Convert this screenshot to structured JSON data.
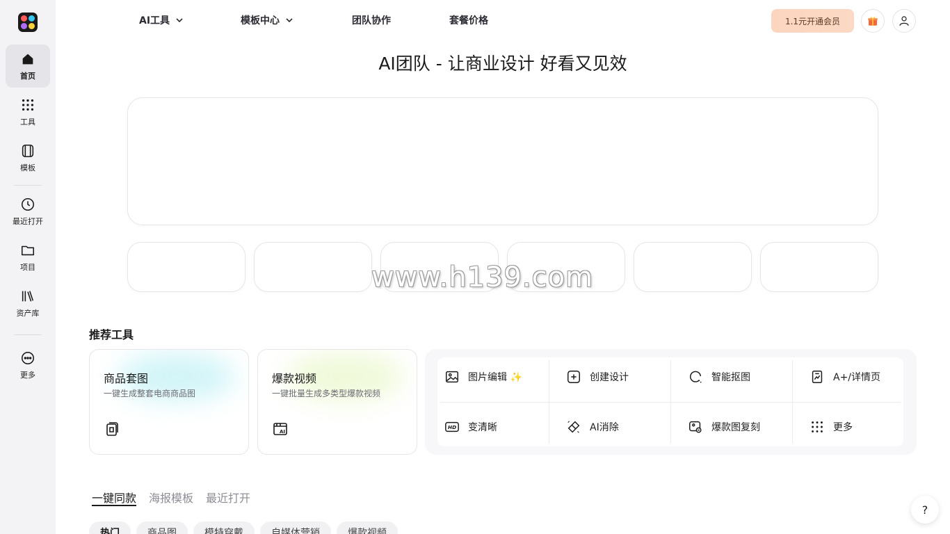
{
  "sidebar": {
    "items": [
      {
        "label": "首页",
        "icon": "home-icon",
        "active": true
      },
      {
        "label": "工具",
        "icon": "grid-dots-icon"
      },
      {
        "label": "模板",
        "icon": "template-icon"
      },
      {
        "label": "最近打开",
        "icon": "clock-icon"
      },
      {
        "label": "项目",
        "icon": "folder-icon"
      },
      {
        "label": "资产库",
        "icon": "library-icon"
      },
      {
        "label": "更多",
        "icon": "more-circle-icon"
      }
    ]
  },
  "nav": {
    "items": [
      {
        "label": "AI工具",
        "has_dropdown": true
      },
      {
        "label": "模板中心",
        "has_dropdown": true
      },
      {
        "label": "团队协作"
      },
      {
        "label": "套餐价格"
      }
    ],
    "vip_button": "1.1元开通会员",
    "gift_icon": "gift-icon",
    "user_icon": "user-icon"
  },
  "hero": {
    "title": "AI团队 - 让商业设计 好看又见效"
  },
  "watermark": "www.h139.com",
  "recommended": {
    "title": "推荐工具",
    "cards": [
      {
        "title": "商品套图",
        "subtitle": "一键生成整套电商商品图",
        "icon": "product-set-icon",
        "glow": "#bff0f5"
      },
      {
        "title": "爆款视频",
        "subtitle": "一键批量生成多类型爆款视频",
        "icon": "ai-video-icon",
        "glow": "#e9f7c9"
      }
    ],
    "grid": [
      {
        "label": "图片编辑 ✨",
        "icon": "image-edit-icon"
      },
      {
        "label": "创建设计",
        "icon": "plus-square-icon"
      },
      {
        "label": "智能抠图",
        "icon": "cutout-icon"
      },
      {
        "label": "A+/详情页",
        "icon": "detail-page-icon"
      },
      {
        "label": "变清晰",
        "icon": "hd-icon"
      },
      {
        "label": "AI消除",
        "icon": "eraser-icon"
      },
      {
        "label": "爆款图复刻",
        "icon": "replicate-icon"
      },
      {
        "label": "更多",
        "icon": "grid-dots-icon"
      }
    ]
  },
  "content_tabs": [
    {
      "label": "一键同款",
      "active": true
    },
    {
      "label": "海报模板"
    },
    {
      "label": "最近打开"
    }
  ],
  "chips": [
    {
      "label": "热门",
      "active": true
    },
    {
      "label": "商品图"
    },
    {
      "label": "模特穿戴"
    },
    {
      "label": "自媒体营销"
    },
    {
      "label": "爆款视频"
    }
  ],
  "help_label": "?"
}
